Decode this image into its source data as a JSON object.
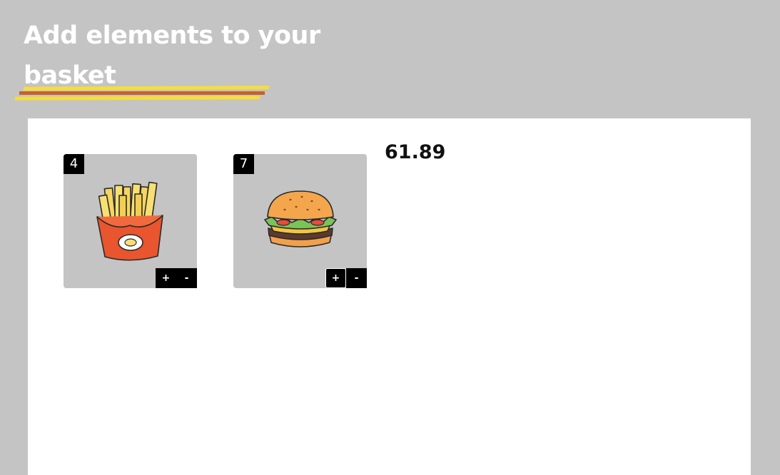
{
  "header": {
    "title_line1": "Add elements to your",
    "title_line2": "basket"
  },
  "basket": {
    "items": [
      {
        "name": "fries",
        "icon": "fries-icon",
        "count": "4",
        "plus_label": "+",
        "minus_label": "-"
      },
      {
        "name": "burger",
        "icon": "burger-icon",
        "count": "7",
        "plus_label": "+",
        "minus_label": "-"
      }
    ],
    "total": "61.89"
  },
  "colors": {
    "background": "#c4c4c4",
    "panel": "#ffffff",
    "underline_yellow": "#f5de3a",
    "underline_orange": "#c8622a",
    "control": "#000000"
  }
}
